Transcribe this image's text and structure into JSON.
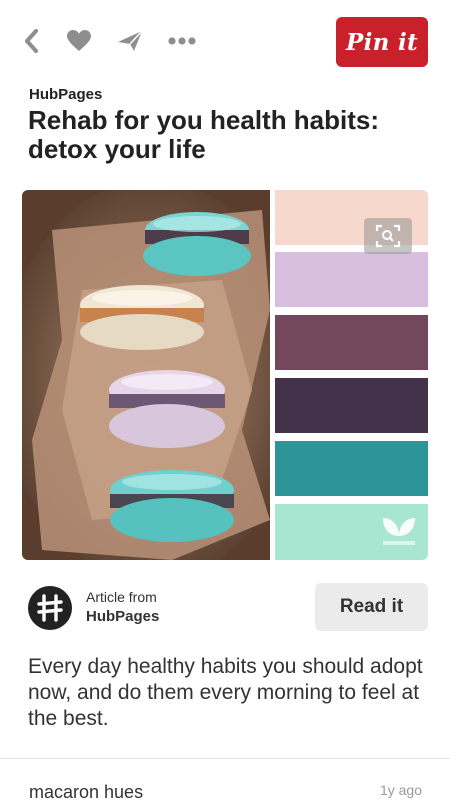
{
  "toolbar": {
    "back_icon": "chevron-left-icon",
    "like_icon": "heart-icon",
    "send_icon": "send-icon",
    "more_icon": "more-dots-icon",
    "pin_label": "Pin it",
    "pin_color": "#c8212b"
  },
  "header": {
    "source": "HubPages",
    "title": "Rehab for you health habits: detox your life"
  },
  "image": {
    "zoom_icon": "visual-search-icon",
    "swatches": [
      "#f6d9cc",
      "#d8bfdf",
      "#73475c",
      "#44324a",
      "#2d9597",
      "#a8e6d2"
    ]
  },
  "article": {
    "label": "Article from",
    "source": "HubPages",
    "read_label": "Read it"
  },
  "description": "Every day healthy habits you should adopt now, and do them every morning to feel at the best.",
  "footer": {
    "board": "macaron hues",
    "time": "1y ago"
  }
}
